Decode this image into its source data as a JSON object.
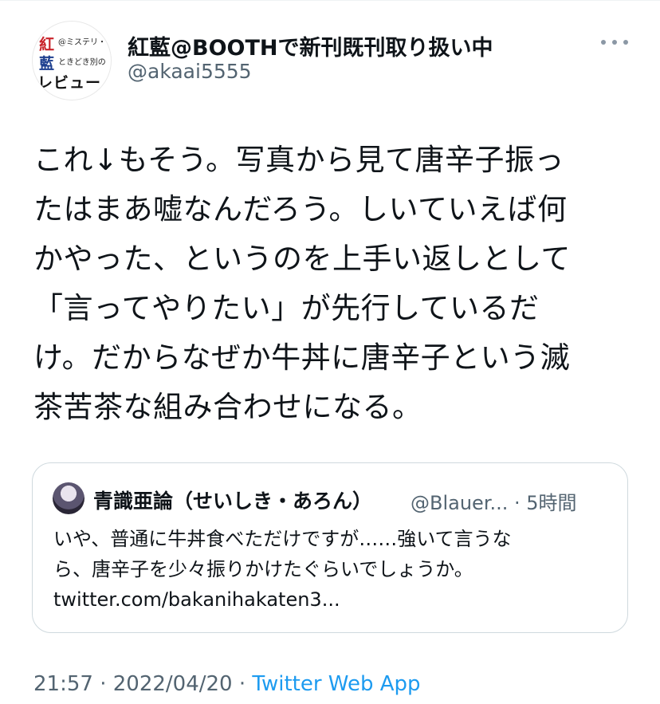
{
  "author": {
    "display_name": "紅藍@BOOTHで新刊既刊取り扱い中",
    "handle": "@akaai5555",
    "avatar": {
      "line_red": "紅",
      "line_blue": "藍",
      "small_top": "@ミステリ・",
      "small_mid": "ときどき別の",
      "big": "レビュー"
    }
  },
  "tweet": {
    "text": "これ↓もそう。写真から見て唐辛子振っ\nたはまあ嘘なんだろう。しいていえば何\nかやった、というのを上手い返しとして\n「言ってやりたい」が先行しているだ\nけ。だからなぜか牛丼に唐辛子という滅\n茶苦茶な組み合わせになる。"
  },
  "quoted": {
    "display_name": "青識亜論（せいしき・あろん）",
    "handle_time": "@Blauer... · 5時間",
    "text": "いや、普通に牛丼食べただけですが……強いて言うな\nら、唐辛子を少々振りかけたぐらいでしょうか。\ntwitter.com/bakanihakaten3..."
  },
  "meta": {
    "time": "21:57",
    "sep1": " · ",
    "date": "2022/04/20",
    "sep2": " · ",
    "source": "Twitter Web App"
  },
  "icons": {
    "more": "more-options-icon"
  },
  "colors": {
    "text": "#0f1419",
    "secondary": "#536471",
    "link": "#1d9bf0",
    "border": "#cfd9de"
  }
}
